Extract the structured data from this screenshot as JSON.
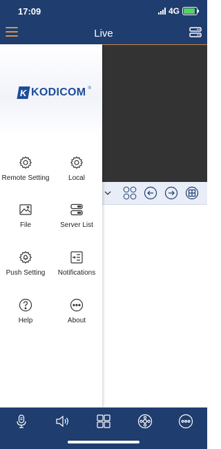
{
  "status_bar": {
    "time": "17:09",
    "network": "4G"
  },
  "header": {
    "title": "Live"
  },
  "logo": {
    "brand": "KODICOM"
  },
  "drawer": {
    "items": [
      {
        "label": "Remote Setting",
        "icon": "gear-icon"
      },
      {
        "label": "Local",
        "icon": "gear-icon"
      },
      {
        "label": "File",
        "icon": "image-icon"
      },
      {
        "label": "Server List",
        "icon": "server-list-icon"
      },
      {
        "label": "Push Setting",
        "icon": "gear-bell-icon"
      },
      {
        "label": "Notifications",
        "icon": "notifications-list-icon"
      },
      {
        "label": "Help",
        "icon": "help-icon"
      },
      {
        "label": "About",
        "icon": "more-icon"
      }
    ]
  },
  "colors": {
    "header_bg": "#1f3d6e",
    "accent": "#d8954a",
    "brand": "#1f4c9a",
    "battery": "#58d162"
  }
}
